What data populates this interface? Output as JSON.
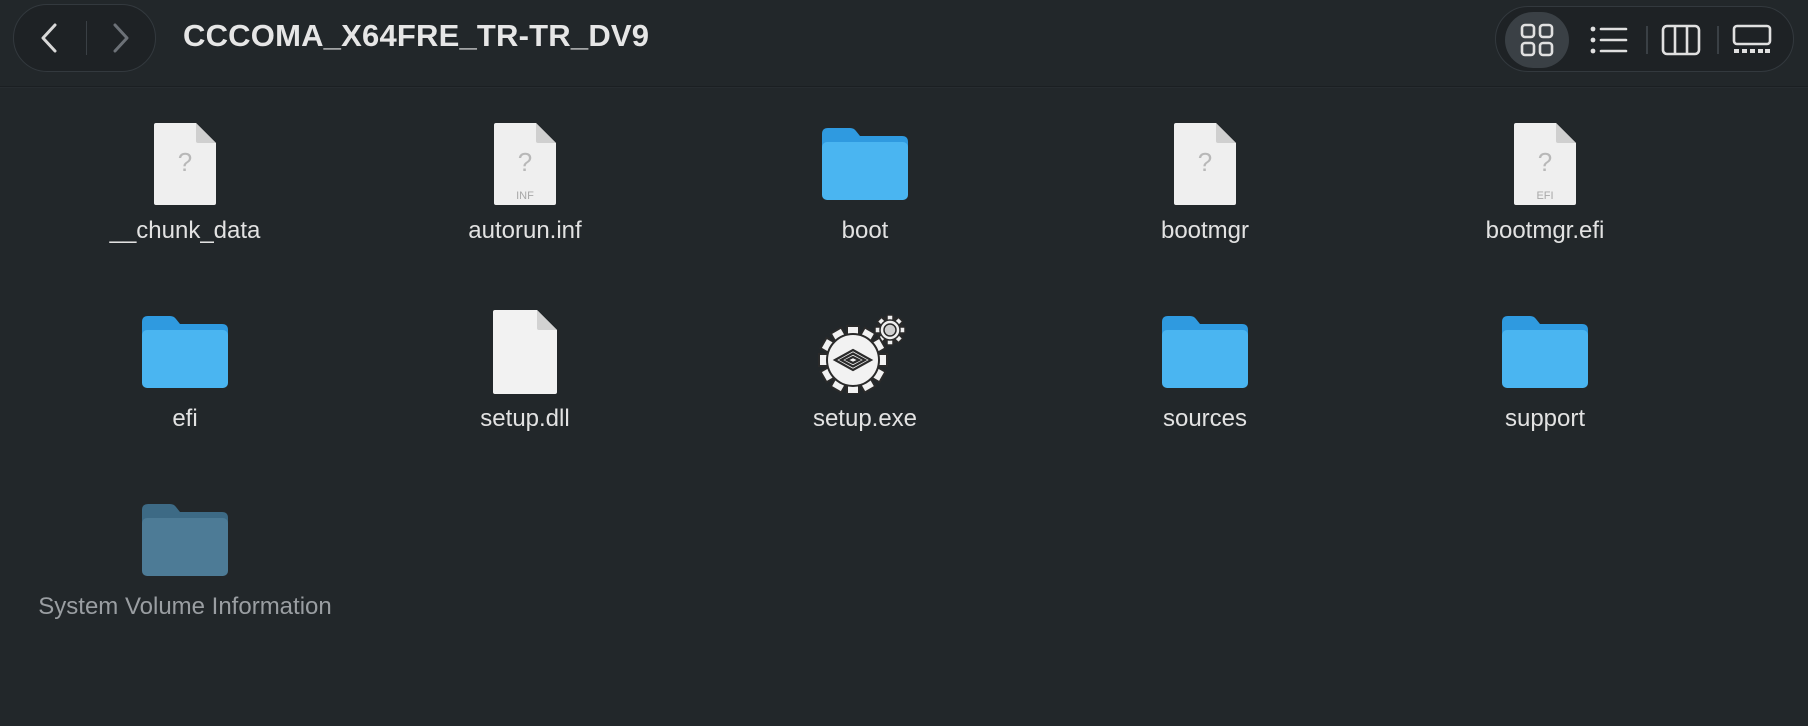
{
  "window": {
    "title": "CCCOMA_X64FRE_TR-TR_DV9"
  },
  "toolbar": {
    "back_icon": "chevron-left-icon",
    "forward_icon": "chevron-right-icon",
    "views": [
      {
        "icon": "icon-view-grid-icon",
        "active": true
      },
      {
        "icon": "list-view-icon",
        "active": false
      },
      {
        "icon": "column-view-icon",
        "active": false
      },
      {
        "icon": "gallery-view-icon",
        "active": false
      }
    ]
  },
  "files": [
    {
      "name": "__chunk_data",
      "kind": "unknown-document",
      "badge": ""
    },
    {
      "name": "autorun.inf",
      "kind": "unknown-document",
      "badge": "INF"
    },
    {
      "name": "boot",
      "kind": "folder"
    },
    {
      "name": "bootmgr",
      "kind": "unknown-document",
      "badge": ""
    },
    {
      "name": "bootmgr.efi",
      "kind": "unknown-document",
      "badge": "EFI"
    },
    {
      "name": "efi",
      "kind": "folder"
    },
    {
      "name": "setup.dll",
      "kind": "blank-document"
    },
    {
      "name": "setup.exe",
      "kind": "executable"
    },
    {
      "name": "sources",
      "kind": "folder"
    },
    {
      "name": "support",
      "kind": "folder"
    },
    {
      "name": "System Volume Information",
      "kind": "hidden-folder"
    }
  ],
  "colors": {
    "background": "#22272a",
    "folder": "#45b0ee",
    "folder_dim": "#4d7b96",
    "text": "#e2e2e2",
    "text_dim": "#9a9ea2"
  }
}
